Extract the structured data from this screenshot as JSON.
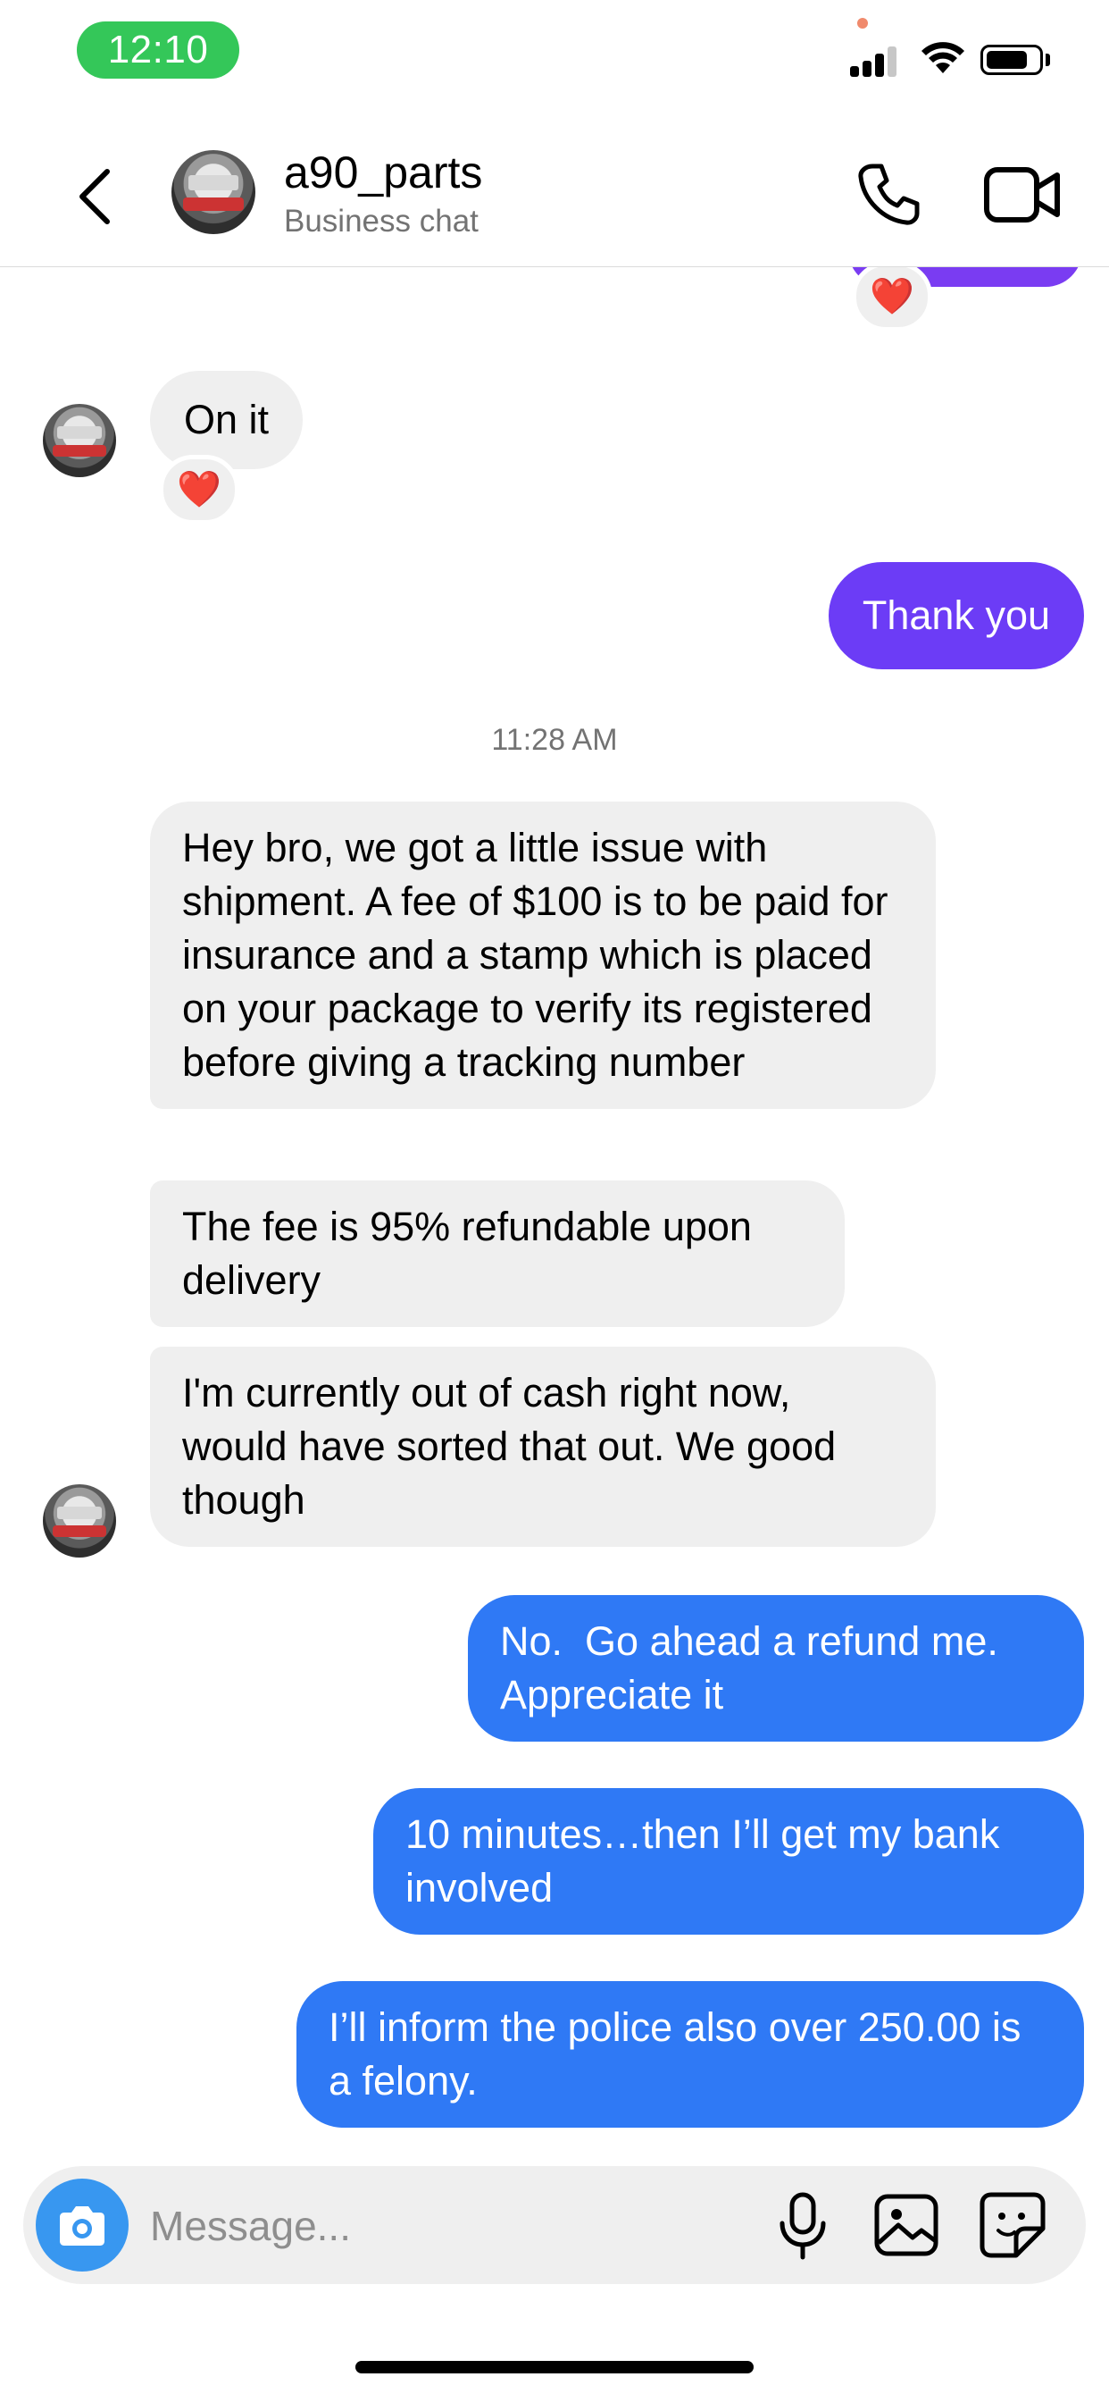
{
  "status_bar": {
    "time": "12:10",
    "battery_level": 0.8,
    "signal_bars_active": 3
  },
  "header": {
    "name": "a90_parts",
    "subtitle": "Business chat"
  },
  "thread": {
    "timestamp": "11:28 AM",
    "messages": [
      {
        "text": "On it",
        "reaction": "❤️"
      },
      {
        "text": "Thank you"
      },
      {
        "text": "Hey bro, we got a little issue with shipment. A fee of $100 is to be paid for insurance and a stamp which is placed on your package to verify its registered before giving a tracking number"
      },
      {
        "text": "The fee is 95% refundable upon delivery"
      },
      {
        "text": "I'm currently out of cash right now, would have sorted that out. We good though"
      },
      {
        "text": "No.  Go ahead a refund me. Appreciate it"
      },
      {
        "text": "10 minutes…then I’ll get my bank involved"
      },
      {
        "text": "I’ll inform the police also over 250.00 is a felony."
      }
    ],
    "top_reaction": "❤️"
  },
  "composer": {
    "placeholder": "Message..."
  },
  "colors": {
    "purple": "#6c3cf6",
    "blue": "#2f79f5",
    "incoming": "#efefef",
    "camera": "#3897f0",
    "time_pill": "#34c759"
  },
  "icons": [
    "back-icon",
    "phone-icon",
    "video-camera-icon",
    "heart-icon",
    "camera-icon",
    "microphone-icon",
    "image-icon",
    "sticker-icon",
    "wifi-icon",
    "battery-icon",
    "signal-icon"
  ]
}
